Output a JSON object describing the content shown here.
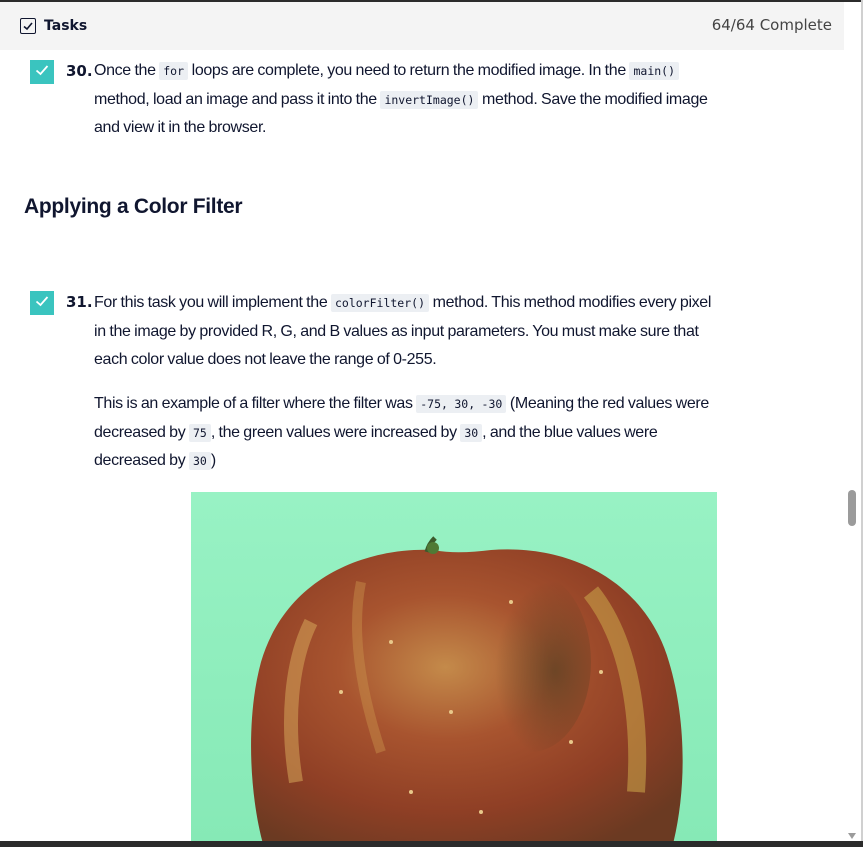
{
  "header": {
    "title": "Tasks",
    "status": "64/64 Complete"
  },
  "tasks": [
    {
      "number": "30.",
      "checked": true,
      "paragraphs": [
        {
          "lines": [
            [
              {
                "t": "Once the "
              },
              {
                "code": "for"
              },
              {
                "t": " loops are complete, you need to return the modified image. In the "
              },
              {
                "code": "main()"
              }
            ],
            [
              {
                "t": "method, load an image and pass it into the "
              },
              {
                "code": "invertImage()"
              },
              {
                "t": " method. Save the modified image"
              }
            ],
            [
              {
                "t": "and view it in the browser."
              }
            ]
          ]
        }
      ]
    },
    {
      "number": "31.",
      "checked": true,
      "paragraphs": [
        {
          "lines": [
            [
              {
                "t": "For this task you will implement the "
              },
              {
                "code": "colorFilter()"
              },
              {
                "t": " method. This method modifies every pixel"
              }
            ],
            [
              {
                "t": "in the image by provided R, G, and B values as input parameters. You must make sure that"
              }
            ],
            [
              {
                "t": "each color value does not leave the range of 0-255."
              }
            ]
          ]
        },
        {
          "lines": [
            [
              {
                "t": "This is an example of a filter where the filter was "
              },
              {
                "code": "-75, 30, -30"
              },
              {
                "t": " (Meaning the red values were"
              }
            ],
            [
              {
                "t": "decreased by "
              },
              {
                "code": "75"
              },
              {
                "t": ", the green values were increased by "
              },
              {
                "code": "30"
              },
              {
                "t": ", and the blue values were"
              }
            ],
            [
              {
                "t": "decreased by "
              },
              {
                "code": "30"
              },
              {
                "t": ")"
              }
            ]
          ]
        }
      ]
    }
  ],
  "section_heading": "Applying a Color Filter",
  "image": {
    "description_icon": "apple-photo",
    "background_color": "#8ff2bf"
  },
  "colors": {
    "accent_check": "#3ac4bf",
    "header_bg": "#f4f4f4",
    "code_bg": "#eceff3"
  }
}
